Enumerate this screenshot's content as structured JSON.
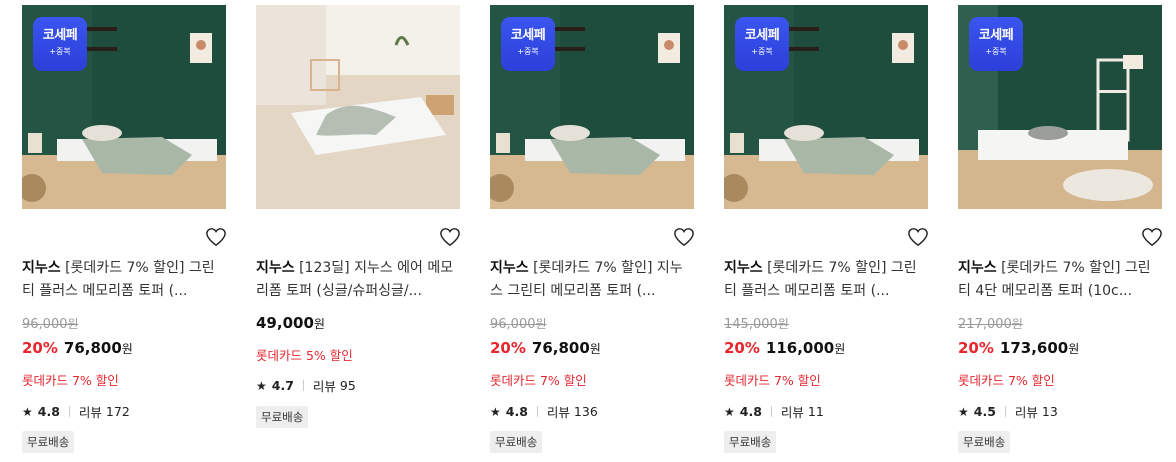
{
  "badge": {
    "label": "코세페",
    "sub": "+중복"
  },
  "shipping_label": "무료배송",
  "review_prefix": "리뷰",
  "currency": "원",
  "products": [
    {
      "brand": "지누스",
      "title": "[롯데카드 7% 할인] 그린티 플러스 메모리폼 토퍼 (...",
      "original_price": "96,000",
      "discount": "20%",
      "price": "76,800",
      "promo": "롯데카드 7% 할인",
      "rating": "4.8",
      "reviews": "172",
      "badge": true
    },
    {
      "brand": "지누스",
      "title": "[123딜] 지누스 에어 메모리폼 토퍼 (싱글/슈퍼싱글/...",
      "original_price": "",
      "discount": "",
      "price": "49,000",
      "promo": "롯데카드 5% 할인",
      "rating": "4.7",
      "reviews": "95",
      "badge": false
    },
    {
      "brand": "지누스",
      "title": "[롯데카드 7% 할인] 지누스 그린티 메모리폼 토퍼 (...",
      "original_price": "96,000",
      "discount": "20%",
      "price": "76,800",
      "promo": "롯데카드 7% 할인",
      "rating": "4.8",
      "reviews": "136",
      "badge": true
    },
    {
      "brand": "지누스",
      "title": "[롯데카드 7% 할인] 그린티 플러스 메모리폼 토퍼 (...",
      "original_price": "145,000",
      "discount": "20%",
      "price": "116,000",
      "promo": "롯데카드 7% 할인",
      "rating": "4.8",
      "reviews": "11",
      "badge": true
    },
    {
      "brand": "지누스",
      "title": "[롯데카드 7% 할인] 그린티 4단 메모리폼 토퍼 (10c...",
      "original_price": "217,000",
      "discount": "20%",
      "price": "173,600",
      "promo": "롯데카드 7% 할인",
      "rating": "4.5",
      "reviews": "13",
      "badge": true
    }
  ]
}
